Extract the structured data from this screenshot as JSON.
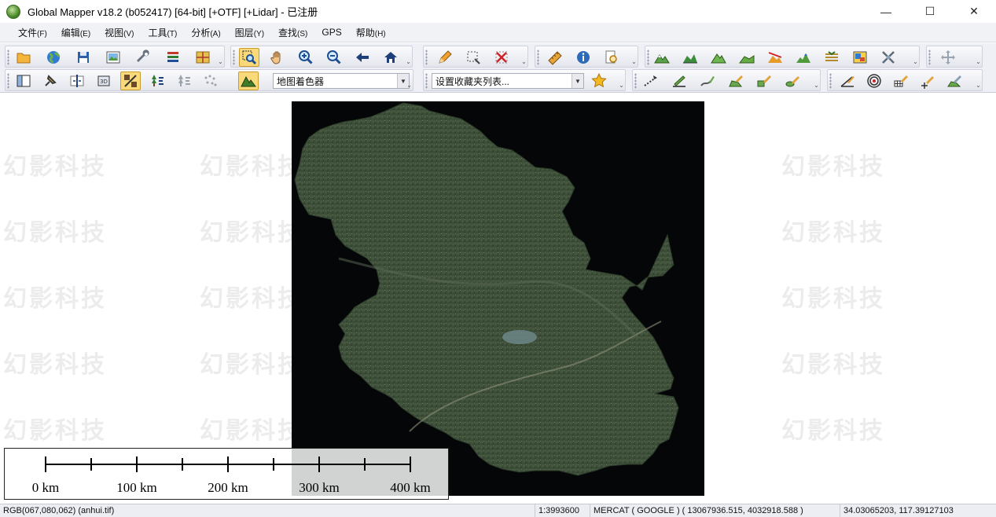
{
  "window": {
    "title": "Global Mapper v18.2 (b052417) [64-bit] [+OTF] [+Lidar] - 已注册",
    "minimize": "—",
    "maximize": "☐",
    "close": "✕"
  },
  "menu": [
    {
      "label": "文件",
      "accel": "(F)"
    },
    {
      "label": "编辑",
      "accel": "(E)"
    },
    {
      "label": "视图",
      "accel": "(V)"
    },
    {
      "label": "工具",
      "accel": "(T)"
    },
    {
      "label": "分析",
      "accel": "(A)"
    },
    {
      "label": "图层",
      "accel": "(Y)"
    },
    {
      "label": "查找",
      "accel": "(S)"
    },
    {
      "label": "GPS",
      "accel": ""
    },
    {
      "label": "帮助",
      "accel": "(H)"
    }
  ],
  "toolbar": {
    "shader_combo": "地图着色器",
    "bookmark_combo": "设置收藏夹列表..."
  },
  "scale_bar": {
    "labels": [
      "0 km",
      "100 km",
      "200 km",
      "300 km",
      "400 km"
    ]
  },
  "watermark": "幻影科技",
  "status": {
    "pixel": "RGB(067,080,062) (anhui.tif)",
    "scale": "1:3993600",
    "projection": "MERCAT ( GOOGLE ) ( 13067936.515, 4032918.588 )",
    "latlon": "34.03065203, 117.39127103"
  },
  "colors": {
    "menu_bg": "#f1f2f6",
    "toolbar_bg": "#eef0f5",
    "active_tool": "#f9d97a",
    "raster_bg": "#050608",
    "terrain": "#3c4e38"
  }
}
